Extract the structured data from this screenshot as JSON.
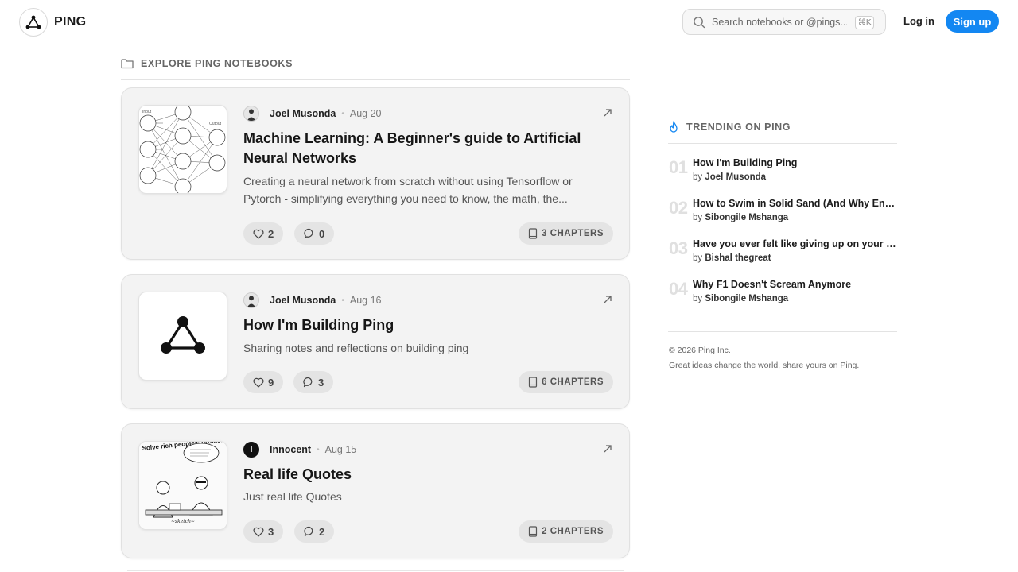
{
  "app": {
    "name": "PING"
  },
  "header": {
    "search_placeholder": "Search notebooks or @pings...",
    "shortcut": "⌘K",
    "login_label": "Log in",
    "signup_label": "Sign up",
    "accent_color": "#1387f2"
  },
  "explore": {
    "label": "EXPLORE PING NOTEBOOKS"
  },
  "cards": [
    {
      "author": "Joel Musonda",
      "date": "Aug 20",
      "title": "Machine Learning: A Beginner's guide to Artificial Neural Networks",
      "description": "Creating a neural network from scratch without using Tensorflow or Pytorch - simplifying everything you need to know, the math, the...",
      "likes": "2",
      "comments": "0",
      "chapters": "3 CHAPTERS",
      "thumb_labels": {
        "input": "Input",
        "output": "Output"
      }
    },
    {
      "author": "Joel Musonda",
      "date": "Aug 16",
      "title": "How I'm Building Ping",
      "description": "Sharing notes and reflections on building ping",
      "likes": "9",
      "comments": "3",
      "chapters": "6 CHAPTERS"
    },
    {
      "author": "Innocent",
      "avatar_initial": "I",
      "date": "Aug 15",
      "title": "Real life Quotes",
      "description": "Just real life Quotes",
      "likes": "3",
      "comments": "2",
      "chapters": "2 CHAPTERS",
      "thumb_caption": "Solve rich people's problem, they pay better."
    }
  ],
  "trending": {
    "label": "TRENDING ON PING",
    "items": [
      {
        "num": "01",
        "title": "How I'm Building Ping",
        "by": "by",
        "author": "Joel Musonda"
      },
      {
        "num": "02",
        "title": "How to Swim in Solid Sand (And Why Engi...",
        "by": "by",
        "author": "Sibongile Mshanga"
      },
      {
        "num": "03",
        "title": "Have you ever felt like giving up on your bi...",
        "by": "by",
        "author": "Bishal thegreat"
      },
      {
        "num": "04",
        "title": "Why F1 Doesn't Scream Anymore",
        "by": "by",
        "author": "Sibongile Mshanga"
      }
    ]
  },
  "footer": {
    "copyright": "© 2026 Ping Inc.",
    "tagline": "Great ideas change the world, share yours on Ping."
  }
}
